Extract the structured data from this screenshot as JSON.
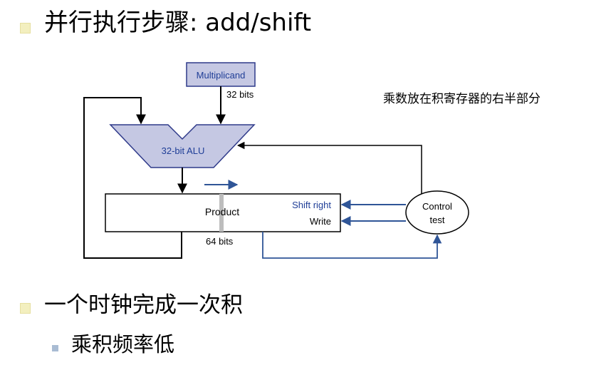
{
  "slide": {
    "title": "并行执行步骤: add/shift",
    "side_note": "乘数放在积寄存器的右半部分",
    "bullet_1": "一个时钟完成一次积",
    "sub_bullet_1": "乘积频率低"
  },
  "diagram": {
    "multiplicand_label": "Multiplicand",
    "multiplicand_bits": "32 bits",
    "alu_label": "32-bit ALU",
    "product_label": "Product",
    "product_bits": "64 bits",
    "shift_right_label": "Shift right",
    "write_label": "Write",
    "control_label_line1": "Control",
    "control_label_line2": "test"
  },
  "colors": {
    "block_fill": "#c5c8e3",
    "block_stroke": "#2f3a8a",
    "blue_text": "#1f3e97",
    "control_arrow": "#2f5597",
    "divider_gray": "#bdbdbd",
    "bullet_main": "#f3efbf",
    "bullet_sub": "#a9bcd3"
  }
}
